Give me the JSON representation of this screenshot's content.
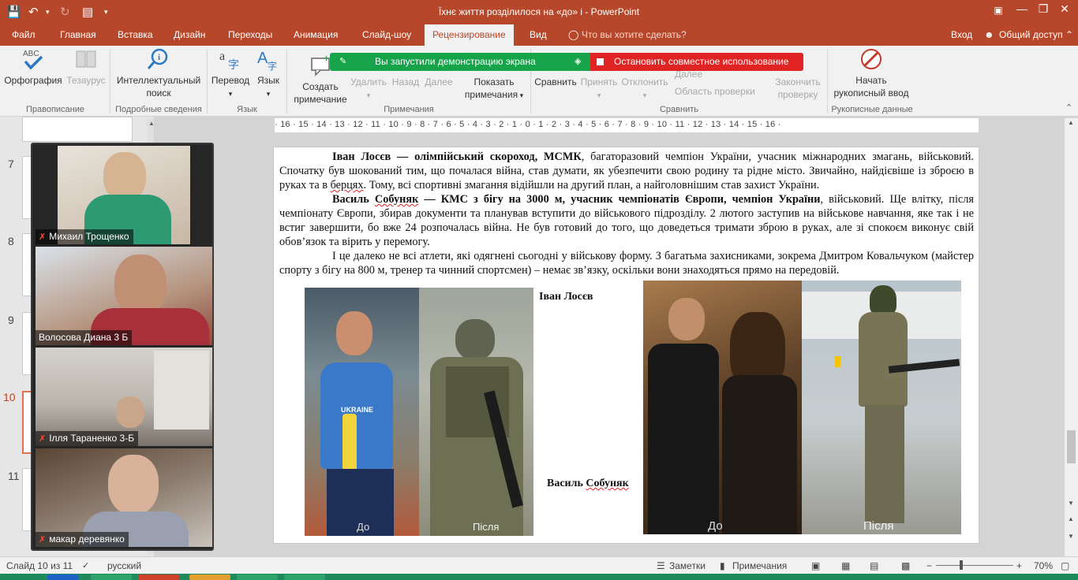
{
  "app": {
    "window_title": "Їхнє життя розділилося на «до» і - PowerPoint",
    "win_minimize": "—",
    "win_restore": "❐",
    "win_close": "✕",
    "ribbon_opts": "▣"
  },
  "tabs": [
    "Файл",
    "Главная",
    "Вставка",
    "Дизайн",
    "Переходы",
    "Анимация",
    "Слайд-шоу",
    "Рецензирование",
    "Вид"
  ],
  "tell_me": "Что вы хотите сделать?",
  "signin": "Вход",
  "share": "Общий доступ",
  "ribbon": {
    "spelling": "Орфография",
    "thesaurus": "Тезаурус",
    "smart_lookup_1": "Интеллектуальный",
    "smart_lookup_2": "поиск",
    "translate": "Перевод",
    "language": "Язык",
    "new_comment_1": "Создать",
    "new_comment_2": "примечание",
    "delete": "Удалить",
    "previous": "Назад",
    "next": "Далее",
    "show_comments_1": "Показать",
    "show_comments_2": "примечания",
    "compare": "Сравнить",
    "accept": "Принять",
    "reject": "Отклонить",
    "prev_small": "Далее",
    "reviewing_pane": "Область проверки",
    "end_review_1": "Закончить",
    "end_review_2": "проверку",
    "start_inking_1": "Начать",
    "start_inking_2": "рукописный ввод",
    "groups": {
      "proofing": "Правописание",
      "insights": "Подробные сведения",
      "language": "Язык",
      "comments": "Примечания",
      "compare": "Сравнить",
      "ink": "Рукописные данные"
    }
  },
  "screenshare": {
    "notice": "Вы запустили демонстрацию экрана",
    "stop": "Остановить совместное использование"
  },
  "ruler": "· 16 · 15 · 14 · 13 · 12 · 11 · 10 · 9 · 8 · 7 · 6 · 5 · 4 · 3 · 2 · 1 · 0 · 1 · 2 · 3 · 4 · 5 · 6 · 7 · 8 · 9 · 10 · 11 · 12 · 13 · 14 · 15 · 16 ·",
  "slides": [
    "7",
    "8",
    "9",
    "10",
    "11"
  ],
  "participants": [
    "Михаил Трощенко",
    "Волосова Диана 3 Б",
    "Ілля Тараненко 3-Б",
    "макар  деревянко"
  ],
  "slide": {
    "p1_bold": "Іван Лосєв — олімпійський скороход, МСМК",
    "p1_rest": ", багаторазовий чемпіон України, учасник міжнародних змагань, військовий. Спочатку був шокований тим, що почалася війна, став думати, як убезпечити свою родину та рідне місто. Звичайно, найдієвіше із зброєю в руках та в ",
    "p1_squig": "берцях",
    "p1_end": ". Тому, всі спортивні змагання відійшли на другий план, а найголовнішим став захист України.",
    "p2_bold1": "Василь ",
    "p2_squig": "Собуняк",
    "p2_bold2": " — КМС з бігу на 3000 м, учасник чемпіонатів Європи, чемпіон України",
    "p2_rest": ", військовий. Ще влітку, після чемпіонату Європи, збирав документи та планував вступити до військового підрозділу. 2 лютого заступив на військове навчання, яке так і не встиг завершити, бо вже 24 розпочалась війна. Не був готовий до того, що доведеться тримати зброю в руках, але зі спокоєм виконує свій обов’язок та вірить у перемогу.",
    "p3": "І це далеко не всі атлети, які одягнені сьогодні у військову форму. З багатьма захисниками, зокрема Дмитром Ковальчуком (майстер спорту з бігу на 800 м, тренер та чинний спортсмен) – немає зв’язку, оскільки вони знаходяться прямо на передовій.",
    "caption1": "Іван Лосєв",
    "caption2a": "Василь ",
    "caption2b": "Собуняк",
    "before": "До",
    "after": "Після",
    "jersey": "UKRAINE"
  },
  "status": {
    "slide_pos": "Слайд 10 из 11",
    "lang": "русский",
    "notes": "Заметки",
    "comments": "Примечания",
    "zoom": "70%"
  },
  "colors": {
    "accent": "#b7472a",
    "share_green": "#16a34a",
    "share_red": "#e02424"
  }
}
